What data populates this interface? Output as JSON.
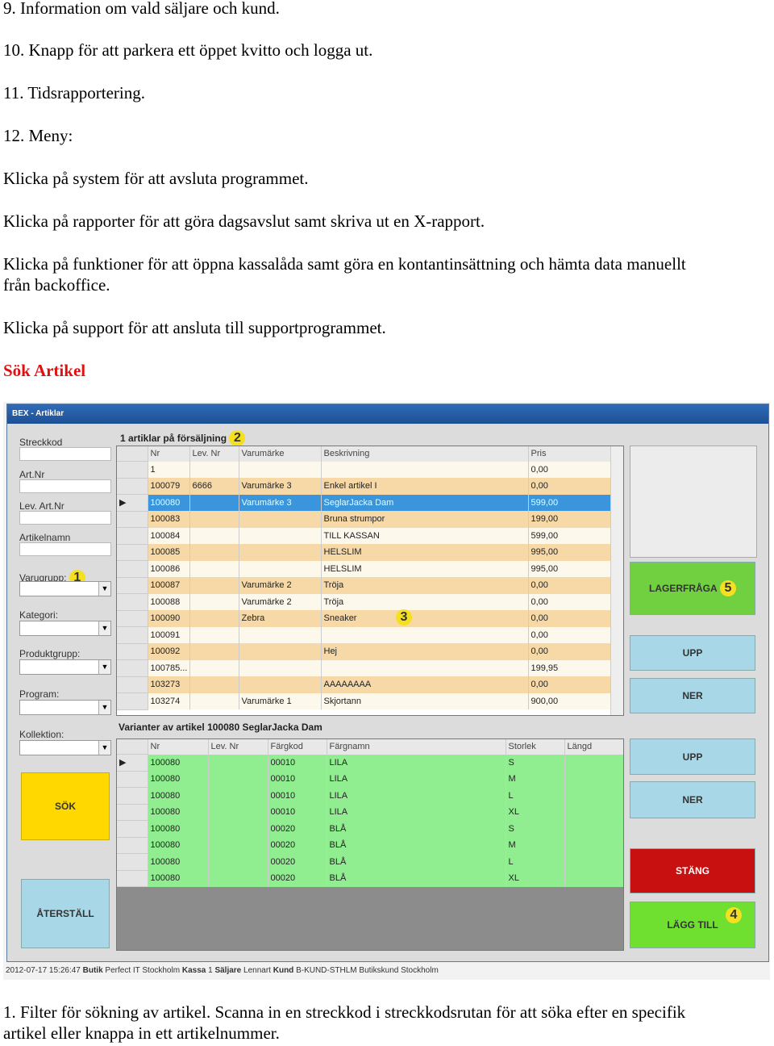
{
  "doc": {
    "lines": [
      "9. Information om vald säljare och kund.",
      "10. Knapp för att parkera ett öppet kvitto och logga ut.",
      "11. Tidsrapportering.",
      "12. Meny:",
      "Klicka på system för att avsluta programmet.",
      "Klicka på rapporter för att göra dagsavslut samt skriva ut en X-rapport.",
      "Klicka på funktioner för att öppna kassalåda samt göra en kontantinsättning och hämta data manuellt från backoffice.",
      "Klicka på support för att ansluta till supportprogrammet."
    ],
    "heading": "Sök Artikel",
    "footer": "1. Filter för sökning av artikel. Scanna in en streckkod i streckkodsrutan för att söka efter en specifik artikel eller knappa in ett artikelnummer."
  },
  "app": {
    "title": "BEX - Artiklar",
    "filters": [
      "Streckkod",
      "Art.Nr",
      "Lev. Art.Nr",
      "Artikelnamn"
    ],
    "dropdowns": [
      "Varugrupp:",
      "Kategori:",
      "Produktgrupp:",
      "Program:",
      "Kollektion:"
    ],
    "badges": [
      "1",
      "2",
      "3",
      "4",
      "5"
    ],
    "search_button": "SÖK",
    "reset_button": "ÅTERSTÄLL",
    "articles_title": "1 artiklar på försäljning",
    "articles": {
      "columns": [
        "Nr",
        "Lev. Nr",
        "Varumärke",
        "Beskrivning",
        "Pris"
      ],
      "rows": [
        [
          "1",
          "",
          "",
          "",
          "0,00"
        ],
        [
          "100079",
          "6666",
          "Varumärke 3",
          "Enkel artikel I",
          "0,00"
        ],
        [
          "100080",
          "",
          "Varumärke 3",
          "SeglarJacka Dam",
          "599,00"
        ],
        [
          "100083",
          "",
          "",
          "Bruna strumpor",
          "199,00"
        ],
        [
          "100084",
          "",
          "",
          "TILL KASSAN",
          "599,00"
        ],
        [
          "100085",
          "",
          "",
          "HELSLIM",
          "995,00"
        ],
        [
          "100086",
          "",
          "",
          "HELSLIM",
          "995,00"
        ],
        [
          "100087",
          "",
          "Varumärke 2",
          "Tröja",
          "0,00"
        ],
        [
          "100088",
          "",
          "Varumärke 2",
          "Tröja",
          "0,00"
        ],
        [
          "100090",
          "",
          "Zebra",
          "Sneaker",
          "0,00"
        ],
        [
          "100091",
          "",
          "",
          "",
          "0,00"
        ],
        [
          "100092",
          "",
          "",
          "Hej",
          "0,00"
        ],
        [
          "100785...",
          "",
          "",
          "",
          "199,95"
        ],
        [
          "103273",
          "",
          "",
          "AAAAAAAA",
          "0,00"
        ],
        [
          "103274",
          "",
          "Varumärke 1",
          "Skjortann",
          "900,00"
        ]
      ],
      "selected_row": 2
    },
    "variants_title": "Varianter av artikel   100080 SeglarJacka Dam",
    "variants": {
      "columns": [
        "Nr",
        "Lev. Nr",
        "Färgkod",
        "Färgnamn",
        "Storlek",
        "Längd"
      ],
      "rows": [
        [
          "100080",
          "",
          "00010",
          "LILA",
          "S",
          ""
        ],
        [
          "100080",
          "",
          "00010",
          "LILA",
          "M",
          ""
        ],
        [
          "100080",
          "",
          "00010",
          "LILA",
          "L",
          ""
        ],
        [
          "100080",
          "",
          "00010",
          "LILA",
          "XL",
          ""
        ],
        [
          "100080",
          "",
          "00020",
          "BLÅ",
          "S",
          ""
        ],
        [
          "100080",
          "",
          "00020",
          "BLÅ",
          "M",
          ""
        ],
        [
          "100080",
          "",
          "00020",
          "BLÅ",
          "L",
          ""
        ],
        [
          "100080",
          "",
          "00020",
          "BLÅ",
          "XL",
          ""
        ]
      ]
    },
    "buttons": {
      "stock": "LAGERFRÅGA",
      "up": "UPP",
      "down": "NER",
      "close": "STÄNG",
      "add": "LÄGG TILL"
    },
    "status": {
      "datetime": "2012-07-17 15:26:47",
      "store_label": "Butik",
      "store": "Perfect IT Stockholm",
      "register_label": "Kassa",
      "register": "1",
      "seller_label": "Säljare",
      "seller": "Lennart",
      "customer_label": "Kund",
      "customer": "B-KUND-STHLM Butikskund Stockholm"
    },
    "colors": {
      "selected": "#3b95dc",
      "row_alt": "#f7d9a8",
      "row": "#fdf8ec",
      "variant_row": "#90ee90",
      "green": "#70d040",
      "red": "#c81010",
      "yellow": "#ffd800",
      "blue_btn": "#a8d8e8"
    }
  }
}
